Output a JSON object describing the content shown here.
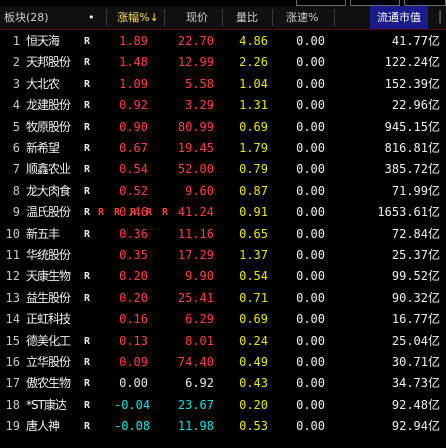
{
  "top_tabs": [
    "",
    "",
    ""
  ],
  "header": {
    "sector": "板块(28)",
    "dot": "•",
    "columns": [
      "涨幅%↓",
      "现价",
      "量比",
      "涨速%",
      "流通市值"
    ],
    "scrollbar_glyph": "▕"
  },
  "rows": [
    {
      "num": "1",
      "name": "恒天海",
      "mark": "R",
      "chg": "1.89",
      "chg_dir": "up",
      "price": "22.70",
      "price_dir": "up",
      "vr": "4.86",
      "speed": "0.00",
      "flow": "41.77亿"
    },
    {
      "num": "2",
      "name": "天邦股份",
      "mark": "R",
      "chg": "1.48",
      "chg_dir": "up",
      "price": "12.99",
      "price_dir": "up",
      "vr": "2.26",
      "speed": "0.00",
      "flow": "122.24亿"
    },
    {
      "num": "3",
      "name": "大北农",
      "mark": "R",
      "chg": "1.09",
      "chg_dir": "up",
      "price": "5.58",
      "price_dir": "up",
      "vr": "1.04",
      "speed": "0.00",
      "flow": "152.39亿"
    },
    {
      "num": "4",
      "name": "龙建股份",
      "mark": "R",
      "chg": "0.92",
      "chg_dir": "up",
      "price": "3.29",
      "price_dir": "up",
      "vr": "1.31",
      "speed": "0.00",
      "flow": "22.96亿"
    },
    {
      "num": "5",
      "name": "牧原股份",
      "mark": "R",
      "chg": "0.90",
      "chg_dir": "up",
      "price": "80.99",
      "price_dir": "up",
      "vr": "0.69",
      "speed": "0.00",
      "flow": "945.15亿"
    },
    {
      "num": "6",
      "name": "新希望",
      "mark": "R",
      "chg": "0.67",
      "chg_dir": "up",
      "price": "19.45",
      "price_dir": "up",
      "vr": "1.79",
      "speed": "0.00",
      "flow": "816.81亿"
    },
    {
      "num": "7",
      "name": "顺鑫农业",
      "mark": "R",
      "chg": "0.54",
      "chg_dir": "up",
      "price": "52.00",
      "price_dir": "up",
      "vr": "0.79",
      "speed": "0.00",
      "flow": "385.72亿"
    },
    {
      "num": "8",
      "name": "龙大肉食",
      "mark": "R",
      "chg": "0.52",
      "chg_dir": "up",
      "price": "9.60",
      "price_dir": "up",
      "vr": "0.87",
      "speed": "0.00",
      "flow": "71.99亿"
    },
    {
      "num": "9",
      "name": "温氏股份",
      "mark": "R",
      "chg": "0.46",
      "chg_dir": "up",
      "price": "41.24",
      "price_dir": "up",
      "vr": "0.91",
      "speed": "0.00",
      "flow": "1653.61亿"
    },
    {
      "num": "10",
      "name": "新五丰",
      "mark": "R",
      "chg": "0.36",
      "chg_dir": "up",
      "price": "11.16",
      "price_dir": "up",
      "vr": "0.65",
      "speed": "0.00",
      "flow": "72.84亿"
    },
    {
      "num": "11",
      "name": "华统股份",
      "mark": "",
      "chg": "0.35",
      "chg_dir": "up",
      "price": "17.29",
      "price_dir": "up",
      "vr": "1.37",
      "speed": "0.00",
      "flow": "25.37亿"
    },
    {
      "num": "12",
      "name": "天康生物",
      "mark": "R",
      "chg": "0.20",
      "chg_dir": "up",
      "price": "9.90",
      "price_dir": "up",
      "vr": "0.54",
      "speed": "0.00",
      "flow": "99.52亿"
    },
    {
      "num": "13",
      "name": "益生股份",
      "mark": "R",
      "chg": "0.20",
      "chg_dir": "up",
      "price": "25.41",
      "price_dir": "up",
      "vr": "0.71",
      "speed": "0.00",
      "flow": "90.32亿"
    },
    {
      "num": "14",
      "name": "正虹科技",
      "mark": "",
      "chg": "0.16",
      "chg_dir": "up",
      "price": "6.29",
      "price_dir": "up",
      "vr": "0.69",
      "speed": "0.00",
      "flow": "16.77亿"
    },
    {
      "num": "15",
      "name": "德美化工",
      "mark": "R",
      "chg": "0.13",
      "chg_dir": "up",
      "price": "8.01",
      "price_dir": "up",
      "vr": "0.24",
      "speed": "0.00",
      "flow": "25.04亿"
    },
    {
      "num": "16",
      "name": "立华股份",
      "mark": "R",
      "chg": "0.09",
      "chg_dir": "up",
      "price": "74.40",
      "price_dir": "up",
      "vr": "0.49",
      "speed": "0.00",
      "flow": "30.71亿"
    },
    {
      "num": "17",
      "name": "傲农生物",
      "mark": "R",
      "chg": "0.00",
      "chg_dir": "flat",
      "price": "6.92",
      "price_dir": "flat",
      "vr": "0.43",
      "speed": "0.00",
      "flow": "34.73亿"
    },
    {
      "num": "18",
      "name": "*ST康达",
      "mark": "R",
      "chg": "-0.04",
      "chg_dir": "down",
      "price": "23.67",
      "price_dir": "down",
      "vr": "0.20",
      "speed": "0.00",
      "flow": "92.48亿"
    },
    {
      "num": "19",
      "name": "唐人神",
      "mark": "R",
      "chg": "-0.08",
      "chg_dir": "down",
      "price": "11.98",
      "price_dir": "down",
      "vr": "0.53",
      "speed": "0.00",
      "flow": "92.94亿"
    }
  ],
  "row9_extra_marks": [
    "R",
    "R",
    "R",
    "R",
    "R"
  ],
  "colors": {
    "up": "#ff4040",
    "down": "#00e6e6",
    "flat": "#e8e8e8",
    "volratio": "#e8e800",
    "header_bg": "#101010",
    "selected_bg": "#1a1a8a"
  }
}
